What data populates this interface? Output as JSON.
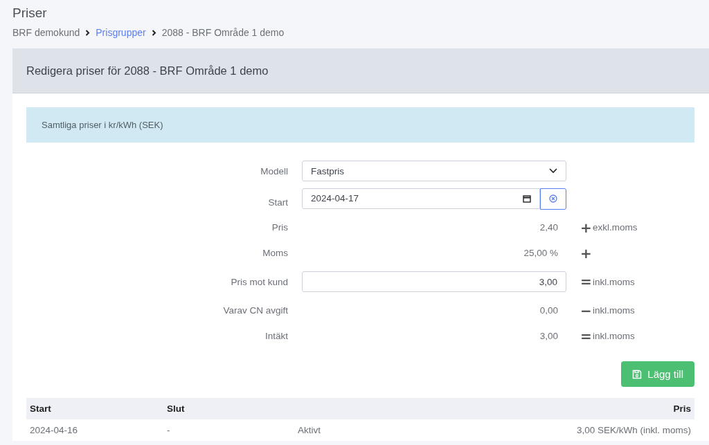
{
  "page": {
    "title": "Priser"
  },
  "breadcrumb": [
    {
      "label": "BRF demokund",
      "link": false
    },
    {
      "label": "Prisgrupper",
      "link": true
    },
    {
      "label": "2088 - BRF Område 1 demo",
      "link": false
    }
  ],
  "card": {
    "title": "Redigera priser för 2088 - BRF Område 1 demo"
  },
  "alert": "Samtliga priser i kr/kWh (SEK)",
  "form": [
    {
      "kind": "select",
      "label": "Modell",
      "value": "Fastpris"
    },
    {
      "kind": "date",
      "label": "Start",
      "value": "2024-04-17"
    },
    {
      "kind": "static",
      "label": "Pris",
      "value": "2,40",
      "operator": "+",
      "suffix": "exkl.moms"
    },
    {
      "kind": "static",
      "label": "Moms",
      "value": "25,00 %",
      "operator": "+"
    },
    {
      "kind": "input",
      "label": "Pris mot kund",
      "value": "3,00",
      "operator": "=",
      "suffix": "inkl.moms"
    },
    {
      "kind": "static",
      "label": "Varav CN avgift",
      "value": "0,00",
      "operator": "−",
      "suffix": "inkl.moms"
    },
    {
      "kind": "static",
      "label": "Intäkt",
      "value": "3,00",
      "operator": "=",
      "suffix": "inkl.moms"
    }
  ],
  "add_button": "Lägg till",
  "table": {
    "columns": [
      {
        "label": "Start",
        "kind": "text"
      },
      {
        "label": "Slut",
        "kind": "text"
      },
      {
        "kind": "text"
      },
      {
        "label": "Pris",
        "kind": "numeric"
      }
    ],
    "rows": [
      {
        "cells": [
          "2024-04-16",
          "-",
          "Aktivt",
          "3,00 SEK/kWh (inkl. moms)"
        ]
      }
    ]
  }
}
